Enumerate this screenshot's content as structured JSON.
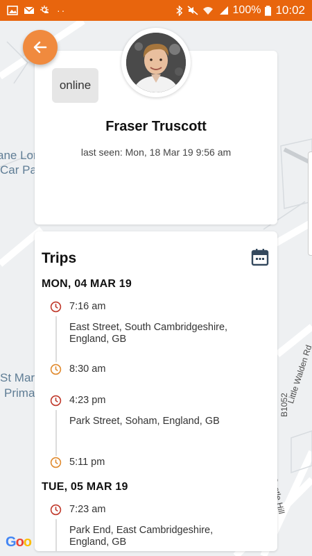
{
  "status_bar": {
    "battery": "100%",
    "time": "10:02"
  },
  "map": {
    "labels": [
      "ane Lor",
      "Car Pa",
      "St Mar",
      "Prima"
    ],
    "roads": [
      "Little Walden Rd",
      "B1052",
      "Castle Hill"
    ],
    "attribution": "Google"
  },
  "profile": {
    "status": "online",
    "name": "Fraser Truscott",
    "last_seen": "last seen: Mon, 18 Mar 19 9:56 am"
  },
  "trips": {
    "title": "Trips",
    "days": [
      {
        "date": "MON, 04 MAR 19",
        "entries": [
          {
            "time": "7:16 am",
            "address": "East Street, South Cambridgeshire, England, GB",
            "kind": "start"
          },
          {
            "time": "8:30 am",
            "address": "",
            "kind": "end"
          },
          {
            "time": "4:23 pm",
            "address": "Park Street, Soham, England, GB",
            "kind": "start"
          },
          {
            "time": "5:11 pm",
            "address": "",
            "kind": "end"
          }
        ]
      },
      {
        "date": "TUE, 05 MAR 19",
        "entries": [
          {
            "time": "7:23 am",
            "address": "Park End, East Cambridgeshire, England, GB",
            "kind": "start"
          }
        ]
      }
    ]
  },
  "colors": {
    "status_bar": "#e8650d",
    "back_button": "#f08a3e",
    "clock_start": "#c0392b",
    "clock_end": "#e08a2e",
    "calendar": "#34495e"
  }
}
